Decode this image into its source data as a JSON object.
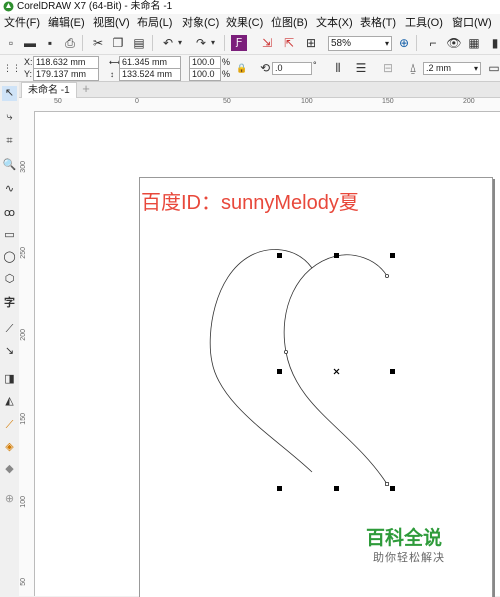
{
  "window": {
    "title": "CorelDRAW X7 (64-Bit) - 未命名 -1"
  },
  "menu": [
    "文件(F)",
    "编辑(E)",
    "视图(V)",
    "布局(L)",
    "对象(C)",
    "效果(C)",
    "位图(B)",
    "文本(X)",
    "表格(T)",
    "工具(O)",
    "窗口(W)"
  ],
  "toolbar": {
    "zoom": "58%"
  },
  "properties": {
    "x_label": "X:",
    "x_value": "118.632 mm",
    "y_label": "Y:",
    "y_value": "179.137 mm",
    "w_value": "61.345 mm",
    "h_value": "133.524 mm",
    "sx_value": "100.0",
    "sy_value": "100.0",
    "pct": "%",
    "angle_value": ".0",
    "degree": "°",
    "outline_value": ".2 mm"
  },
  "tabs": {
    "doc_tab": "未命名 -1",
    "add": "+"
  },
  "ruler": {
    "h_marks": [
      "50",
      "0",
      "50",
      "100",
      "150",
      "200"
    ],
    "v_marks": [
      "300",
      "250",
      "200",
      "150",
      "100",
      "50"
    ]
  },
  "canvas": {
    "watermark_text": "百度ID：sunnyMelody夏",
    "brand_title": "百科全说",
    "brand_subtitle": "助你轻松解决"
  },
  "colors": {
    "accent": "#e8483b",
    "brand": "#2e9b3a"
  }
}
